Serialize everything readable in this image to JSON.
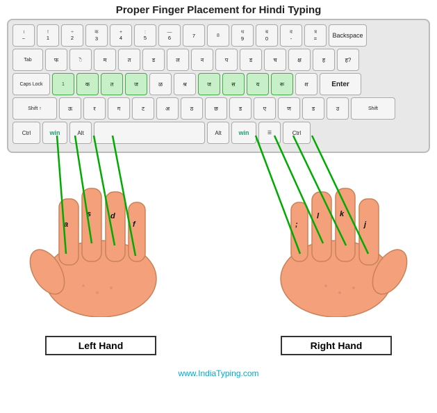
{
  "title": "Proper Finger Placement for Hindi Typing",
  "watermark": "www.IndiaTyping.com",
  "left_hand_label": "Left Hand",
  "right_hand_label": "Right Hand",
  "finger_labels": {
    "a": "a",
    "s": "s",
    "d": "d",
    "f": "f",
    "j": "j",
    "k": "k",
    "l": "l",
    "semi": ";"
  }
}
